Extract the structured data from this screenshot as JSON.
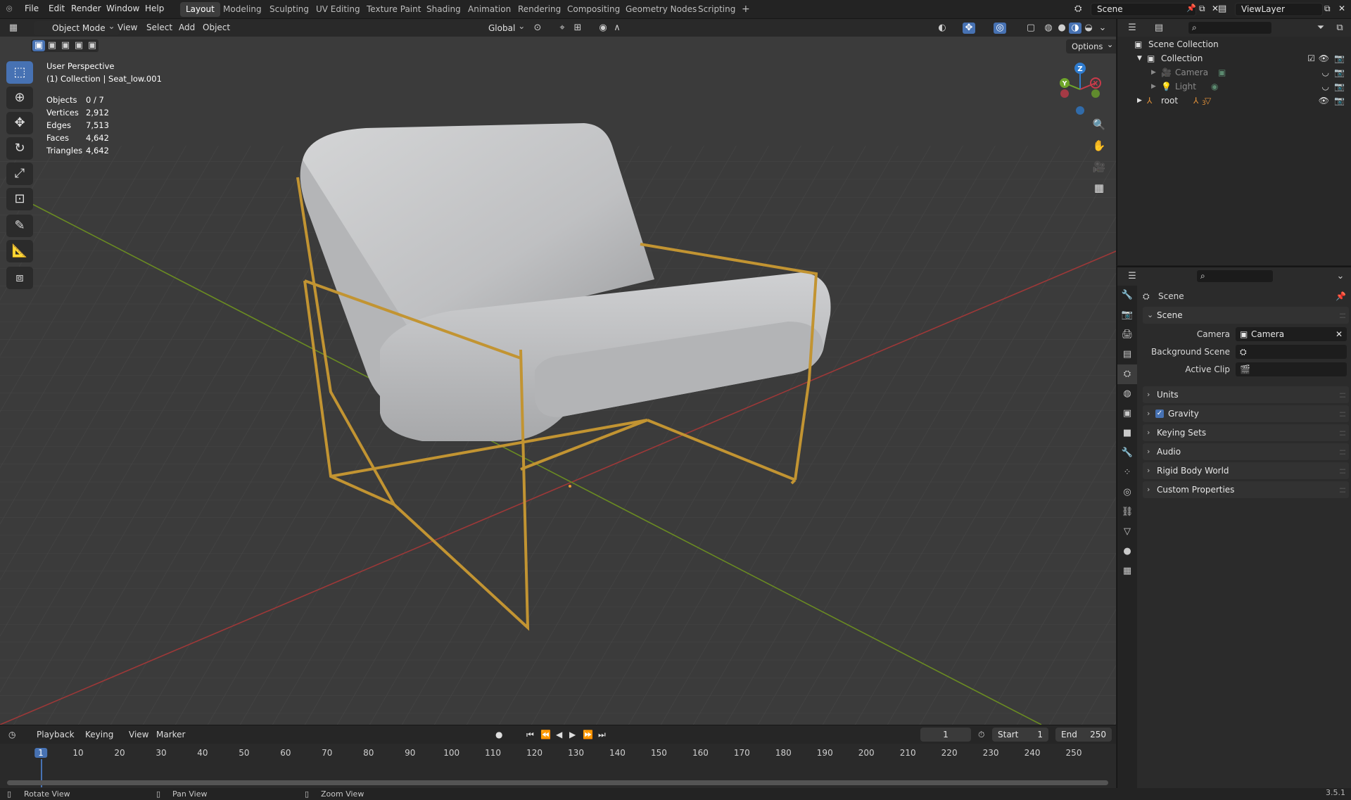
{
  "topbar": {
    "menus": [
      "File",
      "Edit",
      "Render",
      "Window",
      "Help"
    ],
    "workspaces": [
      "Layout",
      "Modeling",
      "Sculpting",
      "UV Editing",
      "Texture Paint",
      "Shading",
      "Animation",
      "Rendering",
      "Compositing",
      "Geometry Nodes",
      "Scripting"
    ],
    "add_tab": "+",
    "scene_name": "Scene",
    "view_layer": "ViewLayer"
  },
  "viewport": {
    "mode": "Object Mode",
    "menus": [
      "View",
      "Select",
      "Add",
      "Object"
    ],
    "transform_orientation": "Global",
    "options_label": "Options",
    "info_title": "User Perspective",
    "info_subtitle": "(1) Collection | Seat_low.001",
    "stats": [
      {
        "label": "Objects",
        "value": "0 / 7"
      },
      {
        "label": "Vertices",
        "value": "2,912"
      },
      {
        "label": "Edges",
        "value": "7,513"
      },
      {
        "label": "Faces",
        "value": "4,642"
      },
      {
        "label": "Triangles",
        "value": "4,642"
      }
    ],
    "gizmo_axes": {
      "z": "Z",
      "y": "Y",
      "x": "X"
    },
    "colors": {
      "background": "#3c3c3c",
      "grid": "#444444",
      "x_axis": "#a23b3b",
      "y_axis": "#6b8f22",
      "fabric": "#c9cacb",
      "frame": "#b98a2e",
      "accent": "#4772b3"
    }
  },
  "timeline": {
    "menus": [
      "Playback",
      "Keying",
      "View",
      "Marker"
    ],
    "current_frame": "1",
    "start_label": "Start",
    "start_value": "1",
    "end_label": "End",
    "end_value": "250",
    "ticks": [
      "1",
      "10",
      "20",
      "30",
      "40",
      "50",
      "60",
      "70",
      "80",
      "90",
      "100",
      "110",
      "120",
      "130",
      "140",
      "150",
      "160",
      "170",
      "180",
      "190",
      "200",
      "210",
      "220",
      "230",
      "240",
      "250"
    ]
  },
  "statusbar": {
    "rotate": "Rotate View",
    "pan": "Pan View",
    "zoom": "Zoom View",
    "version": "3.5.1"
  },
  "outliner": {
    "rows": [
      {
        "label": "Scene Collection",
        "dim": false
      },
      {
        "label": "Collection",
        "dim": false
      },
      {
        "label": "Camera",
        "dim": true
      },
      {
        "label": "Light",
        "dim": true
      },
      {
        "label": "root",
        "dim": false
      }
    ],
    "root_child_count": "3"
  },
  "properties": {
    "context": "Scene",
    "panel_scene": "Scene",
    "camera_label": "Camera",
    "camera_value": "Camera",
    "background_scene_label": "Background Scene",
    "active_clip_label": "Active Clip",
    "subpanels": [
      "Units",
      "Gravity",
      "Keying Sets",
      "Audio",
      "Rigid Body World",
      "Custom Properties"
    ]
  }
}
